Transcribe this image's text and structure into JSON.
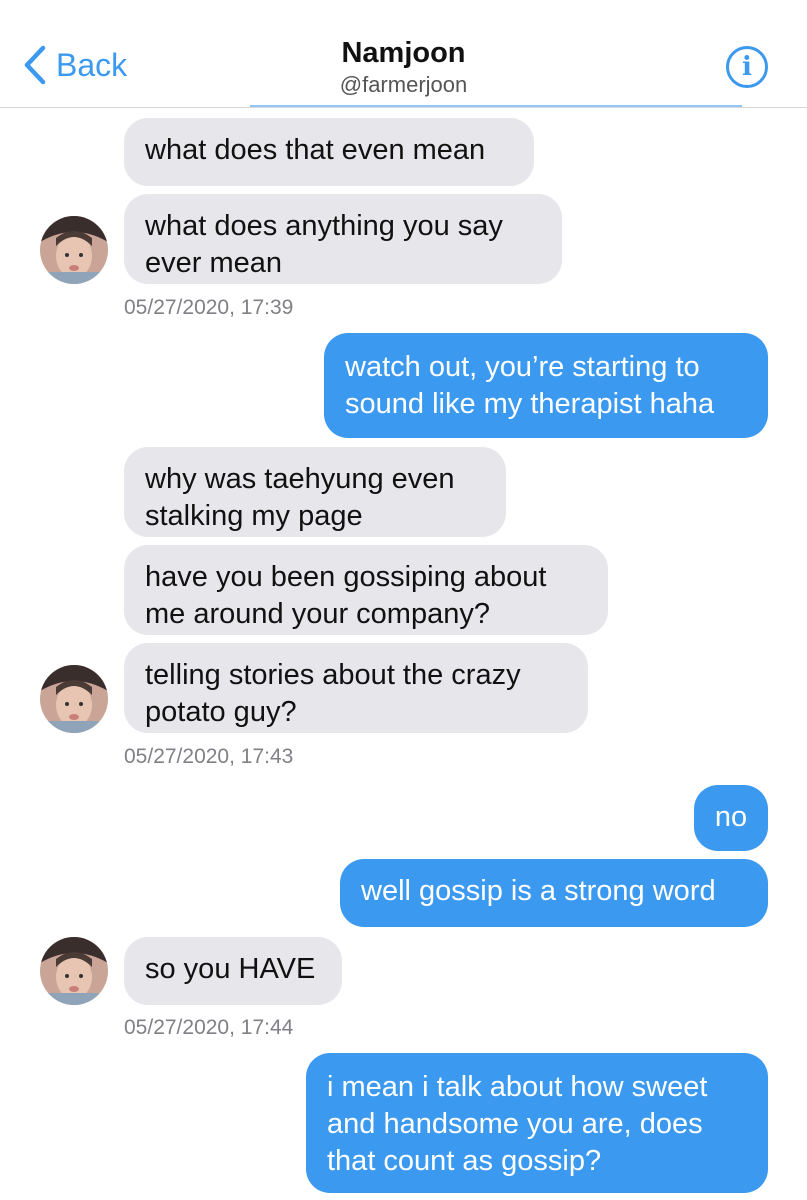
{
  "header": {
    "back_label": "Back",
    "title": "Namjoon",
    "handle": "@farmerjoon",
    "info_label": "i"
  },
  "messages": [
    {
      "dir": "in",
      "text": "what does that even mean"
    },
    {
      "dir": "in",
      "text": "what does anything you say ever mean"
    },
    {
      "dir": "in",
      "text": "why was taehyung even stalking my page"
    },
    {
      "dir": "out",
      "text": "watch out, you’re starting to sound like my therapist haha"
    },
    {
      "dir": "in",
      "text": "have you been gossiping about me around your company?"
    },
    {
      "dir": "in",
      "text": "telling stories about the crazy potato guy?"
    },
    {
      "dir": "out",
      "text": "no"
    },
    {
      "dir": "out",
      "text": "well gossip is a strong word"
    },
    {
      "dir": "in",
      "text": "so you HAVE"
    },
    {
      "dir": "out",
      "text": "i mean i talk about how sweet and handsome you are, does that count as gossip?"
    }
  ],
  "timestamps": [
    "05/27/2020, 17:39",
    "05/27/2020, 17:43",
    "05/27/2020, 17:44"
  ],
  "colors": {
    "accent": "#3b99f0",
    "incoming_bubble": "#e6e6eb",
    "outgoing_text": "#ffffff"
  }
}
